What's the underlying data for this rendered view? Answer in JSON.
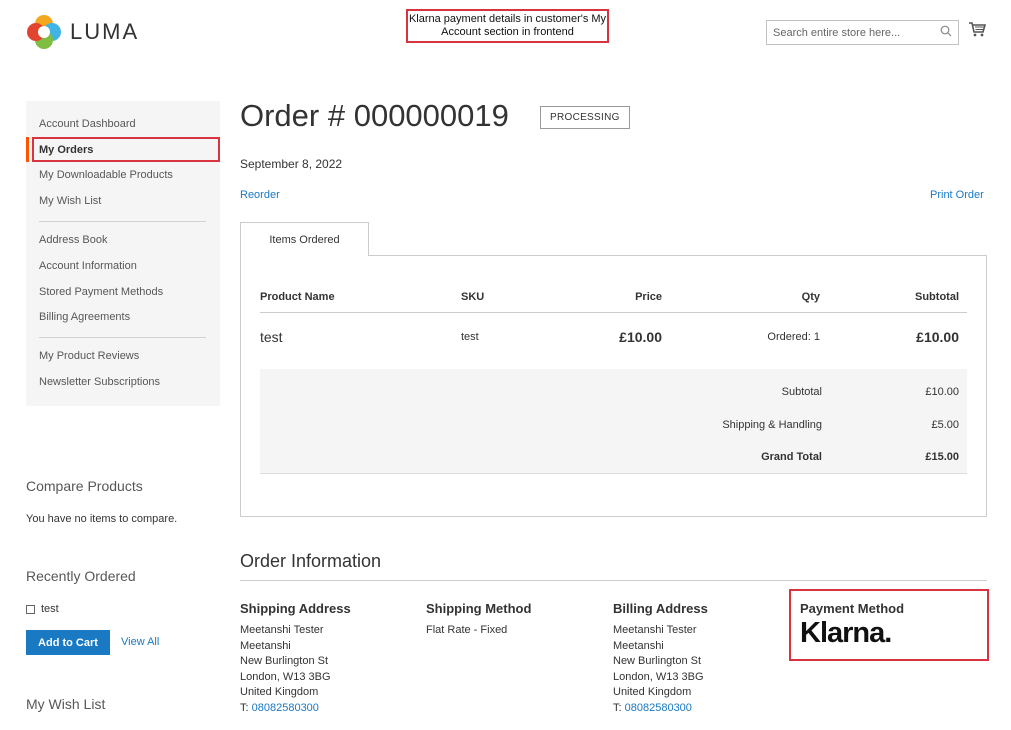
{
  "header": {
    "logo_text": "LUMA",
    "annotation": "Klarna payment details in customer's My Account section in frontend",
    "search_placeholder": "Search entire store here..."
  },
  "sidebar": {
    "items": [
      {
        "label": "Account Dashboard"
      },
      {
        "label": "My Orders",
        "active": true
      },
      {
        "label": "My Downloadable Products"
      },
      {
        "label": "My Wish List"
      },
      {
        "label": "Address Book"
      },
      {
        "label": "Account Information"
      },
      {
        "label": "Stored Payment Methods"
      },
      {
        "label": "Billing Agreements"
      },
      {
        "label": "My Product Reviews"
      },
      {
        "label": "Newsletter Subscriptions"
      }
    ],
    "accent_color": "#ff5501"
  },
  "compare": {
    "title": "Compare Products",
    "empty_text": "You have no items to compare."
  },
  "recently_ordered": {
    "title": "Recently Ordered",
    "item": "test",
    "add_to_cart": "Add to Cart",
    "view_all": "View All"
  },
  "wishlist": {
    "title": "My Wish List"
  },
  "order": {
    "title": "Order # 000000019",
    "status": "PROCESSING",
    "date": "September 8, 2022",
    "reorder": "Reorder",
    "print": "Print Order",
    "tab": "Items Ordered",
    "columns": [
      "Product Name",
      "SKU",
      "Price",
      "Qty",
      "Subtotal"
    ],
    "item": {
      "name": "test",
      "sku": "test",
      "price": "£10.00",
      "qty": "Ordered: 1",
      "subtotal": "£10.00"
    },
    "totals": [
      {
        "label": "Subtotal",
        "value": "£10.00"
      },
      {
        "label": "Shipping & Handling",
        "value": "£5.00"
      },
      {
        "label": "Grand Total",
        "value": "£15.00"
      }
    ]
  },
  "order_info": {
    "title": "Order Information",
    "shipping_address": {
      "title": "Shipping Address",
      "lines": [
        "Meetanshi Tester",
        "Meetanshi",
        "New Burlington St",
        "London, W13 3BG",
        "United Kingdom"
      ],
      "phone_prefix": "T:",
      "phone": "08082580300"
    },
    "shipping_method": {
      "title": "Shipping Method",
      "value": "Flat Rate - Fixed"
    },
    "billing_address": {
      "title": "Billing Address",
      "lines": [
        "Meetanshi Tester",
        "Meetanshi",
        "New Burlington St",
        "London, W13 3BG",
        "United Kingdom"
      ],
      "phone_prefix": "T:",
      "phone": "08082580300"
    },
    "payment_method": {
      "title": "Payment Method",
      "logo_text": "Klarna."
    }
  },
  "colors": {
    "link": "#1979c3",
    "annotation_border": "#d9333f"
  }
}
